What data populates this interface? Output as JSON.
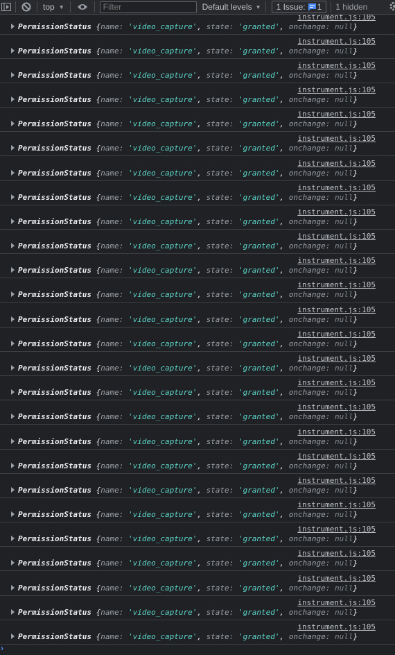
{
  "toolbar": {
    "context": "top",
    "filter_placeholder": "Filter",
    "levels_label": "Default levels",
    "issues_label": "1 Issue:",
    "issues_count": "1",
    "hidden_label": "1 hidden",
    "icons": [
      "sidebar-toggle-icon",
      "clear-console-icon",
      "eye-icon",
      "chevron-down-icon",
      "message-icon",
      "gear-icon"
    ]
  },
  "accent_color": "#4a8af4",
  "string_color": "#5cd5c8",
  "log_entries": [
    {
      "source": "instrument.js:105",
      "class": "PermissionStatus",
      "name": "video_capture",
      "state": "granted",
      "onchange": "null"
    },
    {
      "source": "instrument.js:105",
      "class": "PermissionStatus",
      "name": "video_capture",
      "state": "granted",
      "onchange": "null"
    },
    {
      "source": "instrument.js:105",
      "class": "PermissionStatus",
      "name": "video_capture",
      "state": "granted",
      "onchange": "null"
    },
    {
      "source": "instrument.js:105",
      "class": "PermissionStatus",
      "name": "video_capture",
      "state": "granted",
      "onchange": "null"
    },
    {
      "source": "instrument.js:105",
      "class": "PermissionStatus",
      "name": "video_capture",
      "state": "granted",
      "onchange": "null"
    },
    {
      "source": "instrument.js:105",
      "class": "PermissionStatus",
      "name": "video_capture",
      "state": "granted",
      "onchange": "null"
    },
    {
      "source": "instrument.js:105",
      "class": "PermissionStatus",
      "name": "video_capture",
      "state": "granted",
      "onchange": "null"
    },
    {
      "source": "instrument.js:105",
      "class": "PermissionStatus",
      "name": "video_capture",
      "state": "granted",
      "onchange": "null"
    },
    {
      "source": "instrument.js:105",
      "class": "PermissionStatus",
      "name": "video_capture",
      "state": "granted",
      "onchange": "null"
    },
    {
      "source": "instrument.js:105",
      "class": "PermissionStatus",
      "name": "video_capture",
      "state": "granted",
      "onchange": "null"
    },
    {
      "source": "instrument.js:105",
      "class": "PermissionStatus",
      "name": "video_capture",
      "state": "granted",
      "onchange": "null"
    },
    {
      "source": "instrument.js:105",
      "class": "PermissionStatus",
      "name": "video_capture",
      "state": "granted",
      "onchange": "null"
    },
    {
      "source": "instrument.js:105",
      "class": "PermissionStatus",
      "name": "video_capture",
      "state": "granted",
      "onchange": "null"
    },
    {
      "source": "instrument.js:105",
      "class": "PermissionStatus",
      "name": "video_capture",
      "state": "granted",
      "onchange": "null"
    },
    {
      "source": "instrument.js:105",
      "class": "PermissionStatus",
      "name": "video_capture",
      "state": "granted",
      "onchange": "null"
    },
    {
      "source": "instrument.js:105",
      "class": "PermissionStatus",
      "name": "video_capture",
      "state": "granted",
      "onchange": "null"
    },
    {
      "source": "instrument.js:105",
      "class": "PermissionStatus",
      "name": "video_capture",
      "state": "granted",
      "onchange": "null"
    },
    {
      "source": "instrument.js:105",
      "class": "PermissionStatus",
      "name": "video_capture",
      "state": "granted",
      "onchange": "null"
    },
    {
      "source": "instrument.js:105",
      "class": "PermissionStatus",
      "name": "video_capture",
      "state": "granted",
      "onchange": "null"
    },
    {
      "source": "instrument.js:105",
      "class": "PermissionStatus",
      "name": "video_capture",
      "state": "granted",
      "onchange": "null"
    },
    {
      "source": "instrument.js:105",
      "class": "PermissionStatus",
      "name": "video_capture",
      "state": "granted",
      "onchange": "null"
    },
    {
      "source": "instrument.js:105",
      "class": "PermissionStatus",
      "name": "video_capture",
      "state": "granted",
      "onchange": "null"
    },
    {
      "source": "instrument.js:105",
      "class": "PermissionStatus",
      "name": "video_capture",
      "state": "granted",
      "onchange": "null"
    },
    {
      "source": "instrument.js:105",
      "class": "PermissionStatus",
      "name": "video_capture",
      "state": "granted",
      "onchange": "null"
    },
    {
      "source": "instrument.js:105",
      "class": "PermissionStatus",
      "name": "video_capture",
      "state": "granted",
      "onchange": "null"
    },
    {
      "source": "instrument.js:105",
      "class": "PermissionStatus",
      "name": "video_capture",
      "state": "granted",
      "onchange": "null"
    }
  ],
  "labels": {
    "name_key": "name",
    "state_key": "state",
    "onchange_key": "onchange"
  }
}
